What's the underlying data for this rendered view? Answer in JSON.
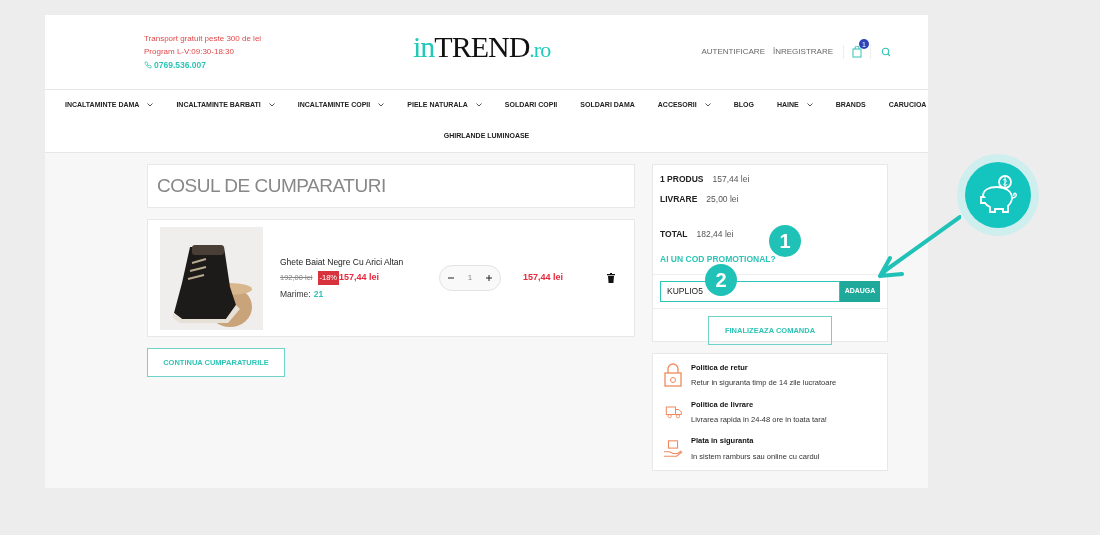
{
  "header": {
    "info": [
      "Transport gratuit peste 300 de lei",
      "Program L-V:09:30-18:30"
    ],
    "phone": "0769.536.007",
    "logo": {
      "part_1": "in",
      "part_2": "TREND",
      "part_3": ".ro"
    },
    "links": [
      "AUTENTIFICARE",
      "ÎNREGISTRARE"
    ],
    "cart_count": "1"
  },
  "nav": [
    {
      "label": "INCALTAMINTE DAMA",
      "dropdown": true
    },
    {
      "label": "INCALTAMINTE BARBATI",
      "dropdown": true
    },
    {
      "label": "INCALTAMINTE COPII",
      "dropdown": true
    },
    {
      "label": "PIELE NATURALA",
      "dropdown": true
    },
    {
      "label": "SOLDARI COPII",
      "dropdown": false
    },
    {
      "label": "SOLDARI DAMA",
      "dropdown": false
    },
    {
      "label": "ACCESORII",
      "dropdown": true
    },
    {
      "label": "BLOG",
      "dropdown": false
    },
    {
      "label": "HAINE",
      "dropdown": true
    },
    {
      "label": "BRANDS",
      "dropdown": false
    },
    {
      "label": "CARUCIOA",
      "dropdown": false
    }
  ],
  "nav_row_2": [
    {
      "label": "GHIRLANDE LUMINOASE",
      "dropdown": false
    }
  ],
  "cart": {
    "title": "COSUL DE CUMPARATURI",
    "items": [
      {
        "name": "Ghete Baiat Negre Cu Arici Altan",
        "old_price": "192,00 lei",
        "discount": "-18%",
        "price": "157,44 lei",
        "size_label": "Marime:",
        "size": "21",
        "quantity": "1",
        "total": "157,44 lei"
      }
    ],
    "continue_button": "CONTINUA CUMPARATURILE"
  },
  "summary": {
    "rows": [
      {
        "label": "1 PRODUS",
        "value": "157,44 lei"
      },
      {
        "label": "LIVRARE",
        "value": "25,00 lei"
      }
    ],
    "total": {
      "label": "TOTAL",
      "value": "182,44 lei"
    },
    "promo_link": "AI UN COD PROMOTIONAL?",
    "promo_value": "KUPLIO5",
    "promo_button": "ADAUGA",
    "checkout_button": "FINALIZEAZA COMANDA"
  },
  "policies": [
    {
      "kind": "return",
      "title": "Politica de retur",
      "text": "Retur in siguranta timp de 14 zile lucratoare"
    },
    {
      "kind": "delivery",
      "title": "Politica de livrare",
      "text": "Livrarea rapida in 24-48 ore in toata tara!"
    },
    {
      "kind": "payment",
      "title": "Plata in siguranta",
      "text": "In sistem ramburs sau online cu cardul"
    }
  ],
  "annotations": [
    {
      "label": "1"
    },
    {
      "label": "2"
    }
  ]
}
